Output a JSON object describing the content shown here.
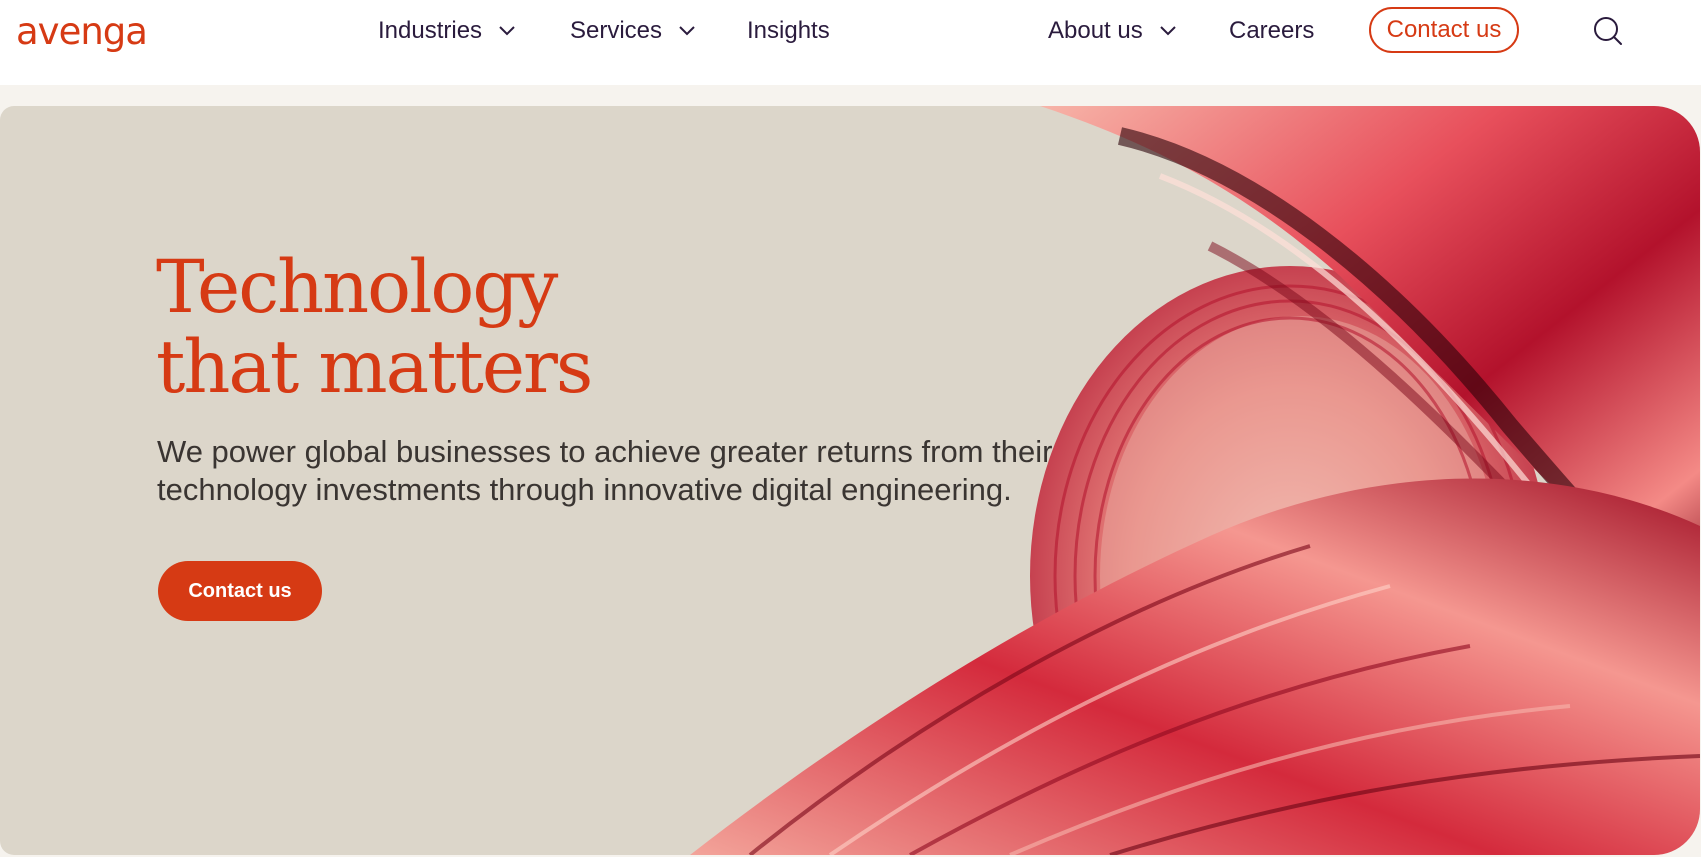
{
  "header": {
    "logo_text": "avenga",
    "nav": {
      "industries": "Industries",
      "services": "Services",
      "insights": "Insights",
      "about": "About us",
      "careers": "Careers"
    },
    "contact_label": "Contact us"
  },
  "hero": {
    "title_line1": "Technology",
    "title_line2": "that matters",
    "subtitle": "We power global businesses to achieve greater returns from their technology investments through innovative digital engineering.",
    "cta_label": "Contact us"
  },
  "colors": {
    "brand": "#d63a14",
    "nav_text": "#2a1b3d",
    "hero_bg": "#dcd6ca",
    "page_bg": "#f6f3ee"
  },
  "icons": {
    "chevron": "chevron-down-icon",
    "search": "search-icon"
  }
}
